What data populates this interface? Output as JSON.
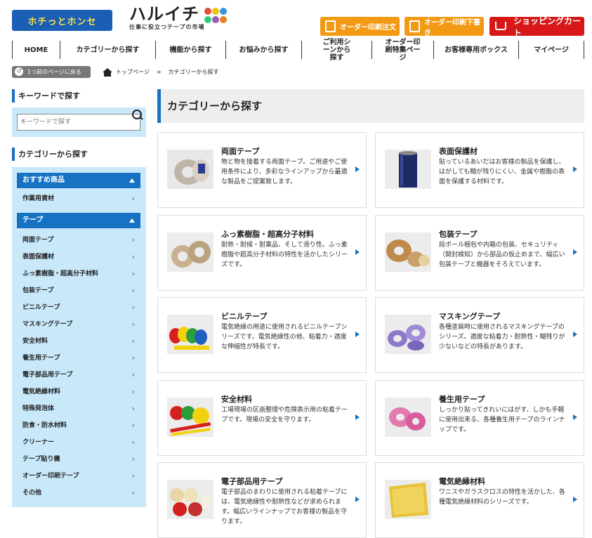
{
  "header": {
    "logo_left_text": "ホチっとホンセ",
    "logo_title": "ハルイチ",
    "logo_sub": "仕事に役立つテープの市場",
    "btn_order_print": "オーダー印刷注文",
    "btn_order_draft": "オーダー印刷下書き",
    "btn_cart": "ショッピングカート",
    "colors": {
      "accent_orange": "#f39a14",
      "cart_red": "#d71718",
      "brand_blue": "#1673c4"
    }
  },
  "nav": [
    "HOME",
    "カテゴリーから探す",
    "機能から探す",
    "お悩みから探す",
    "ご利用シーンから探す",
    "オーダー印刷特集ページ",
    "お客様専用ボックス",
    "マイページ"
  ],
  "breadcrumb": {
    "back_label": "1つ前のページに戻る",
    "home": "トップページ",
    "separator": ">",
    "current": "カテゴリーから探す"
  },
  "sidebar": {
    "keyword_heading": "キーワードで探す",
    "keyword_placeholder": "キーワードで探す",
    "category_heading": "カテゴリーから探す",
    "group1_label": "おすすめ商品",
    "group1_items": [
      "作業用資材"
    ],
    "group2_label": "テープ",
    "group2_items": [
      "両面テープ",
      "表面保護材",
      "ふっ素樹脂・超高分子材料",
      "包装テープ",
      "ビニルテープ",
      "マスキングテープ",
      "安全材料",
      "養生用テープ",
      "電子部品用テープ",
      "電気絶縁材料",
      "特殊発泡体",
      "防食・防水材料",
      "クリーナー",
      "テープ貼り機",
      "オーダー印刷テープ",
      "その他"
    ]
  },
  "main": {
    "title": "カテゴリーから探す",
    "cards": [
      {
        "title": "両面テープ",
        "desc": "物と物を接着する両面テープ。ご用途やご使用条件により、多彩なラインアップから最適な製品をご提案致します。"
      },
      {
        "title": "表面保護材",
        "desc": "貼っているあいだはお客様の製品を保護し、はがしても糊が残りにくい、金属や樹脂の表面を保護する材料です。"
      },
      {
        "title": "ふっ素樹脂・超高分子材料",
        "desc": "耐熱・耐候・耐薬品、そして滑り性。ふっ素樹脂や超高分子材料の特性を活かしたシリーズです。"
      },
      {
        "title": "包装テープ",
        "desc": "段ボール梱包や内箱の包装、セキュリティ（開封検知）から部品の仮止めまで、幅広い包装テープと機器をそろえています。"
      },
      {
        "title": "ビニルテープ",
        "desc": "電気絶縁の用途に使用されるビニルテープシリーズです。電気絶縁性の他、粘着力・適度な伸縮性が特長です。"
      },
      {
        "title": "マスキングテープ",
        "desc": "各種塗装時に使用されるマスキングテープのシリーズ。適度な粘着力・耐熱性・糊残りが少ないなどの特長があります。"
      },
      {
        "title": "安全材料",
        "desc": "工場現場の区画整理や危険表示用の粘着テープです。現場の安全を守ります。"
      },
      {
        "title": "養生用テープ",
        "desc": "しっかり貼ってきれいにはがす、しかも手軽に使用出来る、各種養生用テープのラインナップです。"
      },
      {
        "title": "電子部品用テープ",
        "desc": "電子部品のまわりに使用される粘着テープには、電気絶縁性や耐熱性などが求められます。幅広いラインナップでお客様の製品を守ります。"
      },
      {
        "title": "電気絶縁材料",
        "desc": "ワニスやガラスクロスの特性を活かした、各種電気絶縁材料のシリーズです。"
      }
    ]
  }
}
